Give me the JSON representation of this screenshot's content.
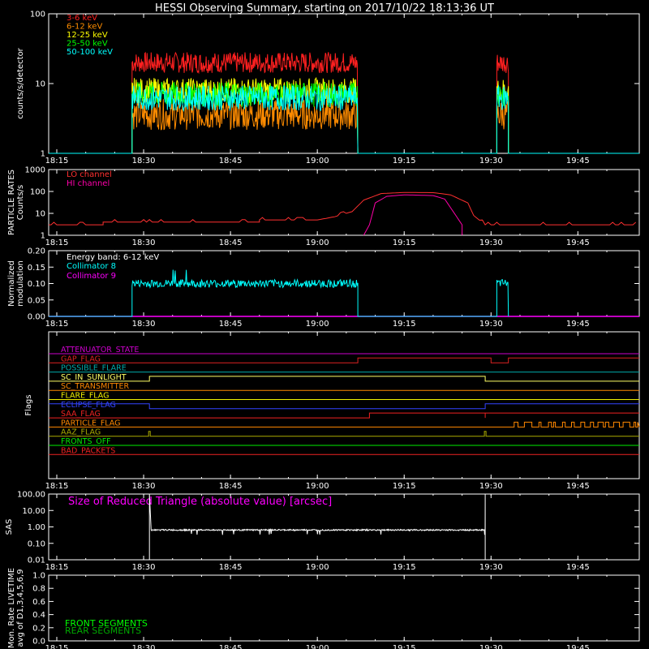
{
  "title": "HESSI Observing Summary, starting on 2017/10/22 18:13:36 UT",
  "x_ticks": [
    "18:15",
    "18:30",
    "18:45",
    "19:00",
    "19:15",
    "19:30",
    "19:45"
  ],
  "colors": {
    "3-6": "#ff2020",
    "6-12": "#ff8c00",
    "12-25": "#ffff00",
    "25-50": "#00ff00",
    "50-100": "#00ffff",
    "lo": "#ff3030",
    "hi": "#ff00aa",
    "coll8": "#00ffff",
    "coll9": "#ff00ff",
    "axis": "#ffffff"
  },
  "chart_data": [
    {
      "type": "line",
      "ylabel": "counts/s/detector",
      "yscale": "log",
      "ylim": [
        1,
        100
      ],
      "ytick_labels": [
        "1",
        "10",
        "100"
      ],
      "legend_placement": "top-left",
      "series": [
        {
          "name": "3-6 keV",
          "color_key": "3-6",
          "level": 20,
          "jitter": 0.15
        },
        {
          "name": "6-12 keV",
          "color_key": "6-12",
          "level": 3.6,
          "jitter": 0.22
        },
        {
          "name": "12-25 keV",
          "color_key": "12-25",
          "level": 8.0,
          "jitter": 0.18
        },
        {
          "name": "25-50 keV",
          "color_key": "25-50",
          "level": 7.0,
          "jitter": 0.18
        },
        {
          "name": "50-100 keV",
          "color_key": "50-100",
          "level": 6.2,
          "jitter": 0.18
        }
      ],
      "intervals": [
        [
          "18:28",
          "19:07"
        ],
        [
          "19:31",
          "19:33"
        ]
      ]
    },
    {
      "type": "line",
      "ylabel": [
        "PARTICLE RATES",
        "Counts/s"
      ],
      "yscale": "log",
      "ylim": [
        1,
        1000
      ],
      "ytick_labels": [
        "1",
        "10",
        "100",
        "1000"
      ],
      "legend_placement": "top-left",
      "series": [
        {
          "name": "LO channel",
          "color_key": "lo",
          "points": [
            [
              "18:13",
              3
            ],
            [
              "18:23",
              3
            ],
            [
              "18:23",
              4
            ],
            [
              "18:50",
              4
            ],
            [
              "18:50",
              5
            ],
            [
              "19:00",
              5
            ],
            [
              "19:03",
              7
            ],
            [
              "19:06",
              12
            ],
            [
              "19:08",
              40
            ],
            [
              "19:11",
              80
            ],
            [
              "19:15",
              90
            ],
            [
              "19:20",
              88
            ],
            [
              "19:23",
              70
            ],
            [
              "19:26",
              30
            ],
            [
              "19:27",
              8
            ],
            [
              "19:29",
              3
            ],
            [
              "19:55",
              3
            ]
          ]
        },
        {
          "name": "HI channel",
          "color_key": "hi",
          "points": [
            [
              "19:08",
              1
            ],
            [
              "19:09",
              3
            ],
            [
              "19:10",
              30
            ],
            [
              "19:12",
              60
            ],
            [
              "19:15",
              70
            ],
            [
              "19:20",
              65
            ],
            [
              "19:22",
              45
            ],
            [
              "19:25",
              3
            ],
            [
              "19:25",
              1
            ]
          ]
        }
      ]
    },
    {
      "type": "line",
      "ylabel": [
        "Normalized",
        "modulation"
      ],
      "ylim": [
        0,
        0.2
      ],
      "ytick_labels": [
        "0.00",
        "0.05",
        "0.10",
        "0.15",
        "0.20"
      ],
      "legend_placement": "top-left",
      "annotation": "Energy band: 6-12 keV",
      "series": [
        {
          "name": "Collimator 8",
          "color_key": "coll8",
          "level": 0.1,
          "jitter": 0.012,
          "intervals": [
            [
              "18:28",
              "19:07"
            ],
            [
              "19:31",
              "19:33"
            ]
          ]
        },
        {
          "name": "Collimator 9",
          "color_key": "coll9",
          "level": 0.0
        }
      ]
    },
    {
      "type": "line",
      "ylabel": "Flags",
      "series": [
        {
          "name": "ATTENUATOR_STATE",
          "color": "#cc00cc",
          "steps": []
        },
        {
          "name": "GAP_FLAG",
          "color": "#dd2222",
          "steps": [
            [
              "19:07",
              1
            ],
            [
              "19:30",
              0
            ],
            [
              "19:33",
              1
            ]
          ]
        },
        {
          "name": "POSSIBLE_FLARE",
          "color": "#00aaaa",
          "steps": []
        },
        {
          "name": "SC_IN_SUNLIGHT",
          "color": "#ffff66",
          "steps": [
            [
              "18:31",
              1
            ],
            [
              "19:29",
              0
            ]
          ]
        },
        {
          "name": "SC_TRANSMITTER",
          "color": "#ff8800",
          "steps": []
        },
        {
          "name": "FLARE_FLAG",
          "color": "#eeee00",
          "steps": []
        },
        {
          "name": "ECLIPSE_FLAG",
          "color": "#3344ff",
          "steps": [
            [
              "18:13",
              1
            ],
            [
              "18:31",
              0
            ],
            [
              "19:29",
              1
            ]
          ]
        },
        {
          "name": "SAA_FLAG",
          "color": "#ee2222",
          "steps": [
            [
              "19:09",
              1
            ],
            [
              "19:29",
              0
            ],
            [
              "19:29",
              1
            ]
          ]
        },
        {
          "name": "PARTICLE_FLAG",
          "color": "#ff8800",
          "steps": [
            [
              "19:34",
              1
            ]
          ],
          "blinking": true
        },
        {
          "name": "AAZ_FLAG",
          "color": "#aaaa00",
          "steps": [],
          "spikes": [
            "18:31",
            "19:29"
          ]
        },
        {
          "name": "FRONTS_OFF",
          "color": "#00ee00",
          "steps": []
        },
        {
          "name": "BAD_PACKETS",
          "color": "#ee2222",
          "steps": []
        }
      ]
    },
    {
      "type": "line",
      "ylabel": "SAS",
      "yscale": "log",
      "ylim": [
        0.01,
        100
      ],
      "ytick_labels": [
        "0.01",
        "0.10",
        "1.00",
        "10.00",
        "100.00"
      ],
      "annotation": "Size of Reduced Triangle (absolute value) [arcsec]",
      "series": [
        {
          "name": "",
          "color_key": "axis",
          "level": 0.65,
          "intervals": [
            [
              "18:31",
              "19:29"
            ]
          ]
        }
      ]
    },
    {
      "type": "line",
      "ylabel": [
        "Mon. Rate LIVETIME",
        "avg of D1,3,4,5,6,9"
      ],
      "ylim": [
        0,
        1.0
      ],
      "ytick_labels": [
        "0.0",
        "0.2",
        "0.4",
        "0.6",
        "0.8",
        "1.0"
      ],
      "series": [
        {
          "name": "FRONT SEGMENTS",
          "color": "#00ff00"
        },
        {
          "name": "REAR SEGMENTS",
          "color": "#00aa00"
        }
      ]
    }
  ]
}
